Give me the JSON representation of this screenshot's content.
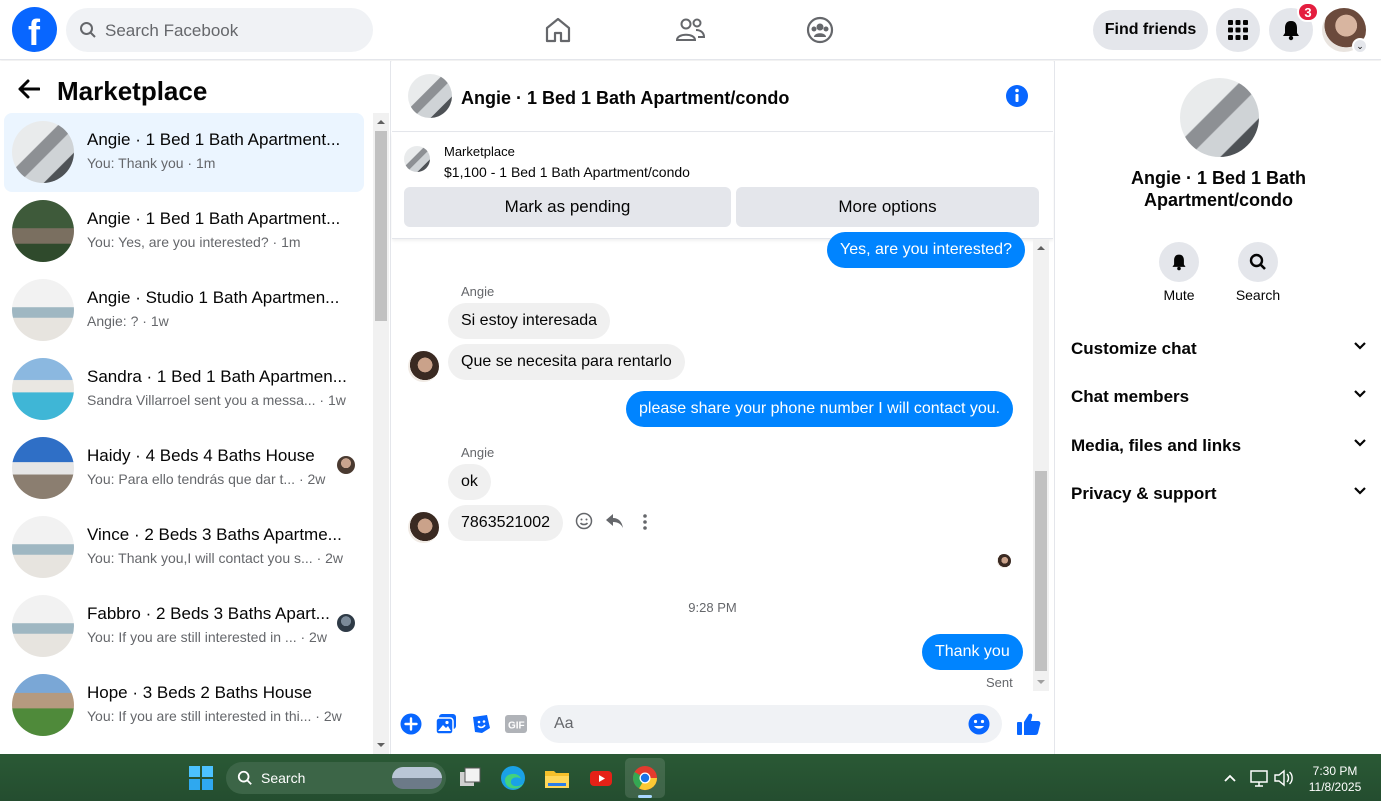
{
  "topbar": {
    "search_placeholder": "Search Facebook",
    "find_friends_label": "Find friends",
    "notification_count": "3",
    "brand_color": "#0866ff"
  },
  "left_panel": {
    "title": "Marketplace",
    "conversations": [
      {
        "title": "Angie · 1 Bed 1 Bath Apartment...",
        "subtitle": "You: Thank you · 1m",
        "active": true
      },
      {
        "title": "Angie · 1 Bed 1 Bath Apartment...",
        "subtitle": "You: Yes, are you interested? · 1m"
      },
      {
        "title": "Angie · Studio 1 Bath Apartmen...",
        "subtitle": "Angie: ? · 1w"
      },
      {
        "title": "Sandra · 1 Bed 1 Bath Apartmen...",
        "subtitle": "Sandra Villarroel sent you a messa... · 1w"
      },
      {
        "title": "Haidy · 4 Beds 4 Baths House",
        "subtitle": "You: Para ello tendrás que dar t... · 2w",
        "read_avatar": true
      },
      {
        "title": "Vince · 2 Beds 3 Baths Apartme...",
        "subtitle": "You: Thank you,I will contact you s... · 2w"
      },
      {
        "title": "Fabbro · 2 Beds 3 Baths Apart...",
        "subtitle": "You: If you are still interested in ... · 2w",
        "read_avatar": true
      },
      {
        "title": "Hope · 3 Beds 2 Baths House",
        "subtitle": "You: If you are still interested in thi... · 2w"
      }
    ]
  },
  "chat": {
    "title": "Angie · 1 Bed 1 Bath Apartment/condo",
    "marketplace_label": "Marketplace",
    "listing": "$1,100 - 1 Bed 1 Bath Apartment/condo",
    "mark_pending_label": "Mark as pending",
    "more_options_label": "More options",
    "messages": {
      "m1": "Yes, are you interested?",
      "sender1": "Angie",
      "m2": "Si estoy interesada",
      "m3": "Que se necesita para rentarlo",
      "m4": "please share your phone number I will contact you.",
      "sender2": "Angie",
      "m5": "ok",
      "m6": "7863521002",
      "timestamp": "9:28 PM",
      "m7": "Thank you",
      "status": "Sent"
    },
    "composer_placeholder": "Aa"
  },
  "details": {
    "name": "Angie · 1 Bed 1 Bath Apartment/condo",
    "mute_label": "Mute",
    "search_label": "Search",
    "sections": [
      "Customize chat",
      "Chat members",
      "Media, files and links",
      "Privacy & support"
    ]
  },
  "taskbar": {
    "search_label": "Search",
    "time": "7:30 PM",
    "date": "11/8/2025"
  }
}
